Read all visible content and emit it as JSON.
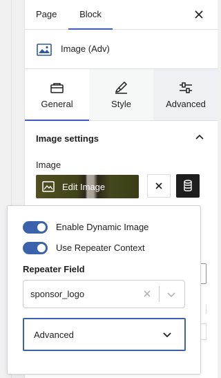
{
  "header": {
    "tab_page": "Page",
    "tab_block": "Block"
  },
  "block": {
    "title": "Image (Adv)"
  },
  "tabs": [
    {
      "label": "General",
      "icon": "toolbox-icon"
    },
    {
      "label": "Style",
      "icon": "brush-icon"
    },
    {
      "label": "Advanced",
      "icon": "sliders-icon"
    }
  ],
  "panel": {
    "title": "Image settings",
    "image_label": "Image",
    "edit_image": "Edit Image"
  },
  "popover": {
    "toggle1": {
      "label": "Enable Dynamic Image",
      "on": true
    },
    "toggle2": {
      "label": "Use Repeater Context",
      "on": true
    },
    "repeater_label": "Repeater Field",
    "repeater_value": "sponsor_logo",
    "dropdown_value": "Advanced"
  },
  "colors": {
    "accent": "#3858e9",
    "toggle": "#3b62ad",
    "dark_button": "#1e1e1e"
  }
}
